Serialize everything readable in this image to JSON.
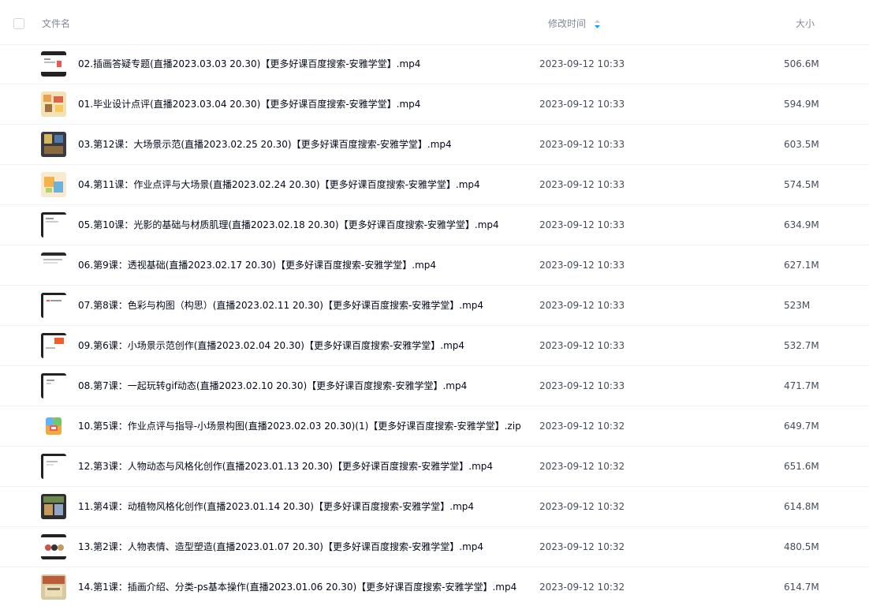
{
  "header": {
    "name_label": "文件名",
    "time_label": "修改时间",
    "size_label": "大小",
    "sort_icon": "sort-descending-icon"
  },
  "colors": {
    "sort_active": "#06a7ff",
    "text": "#03081a",
    "muted": "#818999"
  },
  "files": [
    {
      "name": "02.插画答疑专题(直播2023.03.03 20.30)【更多好课百度搜索-安雅学堂】.mp4",
      "time": "2023-09-12 10:33",
      "size": "506.6M",
      "icon": "video-thumbnail"
    },
    {
      "name": "01.毕业设计点评(直播2023.03.04 20.30)【更多好课百度搜索-安雅学堂】.mp4",
      "time": "2023-09-12 10:33",
      "size": "594.9M",
      "icon": "video-thumbnail"
    },
    {
      "name": "03.第12课：大场景示范(直播2023.02.25 20.30)【更多好课百度搜索-安雅学堂】.mp4",
      "time": "2023-09-12 10:33",
      "size": "603.5M",
      "icon": "video-thumbnail"
    },
    {
      "name": "04.第11课：作业点评与大场景(直播2023.02.24 20.30)【更多好课百度搜索-安雅学堂】.mp4",
      "time": "2023-09-12 10:33",
      "size": "574.5M",
      "icon": "video-thumbnail"
    },
    {
      "name": "05.第10课：光影的基础与材质肌理(直播2023.02.18 20.30)【更多好课百度搜索-安雅学堂】.mp4",
      "time": "2023-09-12 10:33",
      "size": "634.9M",
      "icon": "video-thumbnail"
    },
    {
      "name": "06.第9课：透视基础(直播2023.02.17 20.30)【更多好课百度搜索-安雅学堂】.mp4",
      "time": "2023-09-12 10:33",
      "size": "627.1M",
      "icon": "video-thumbnail"
    },
    {
      "name": "07.第8课：色彩与构图（构思）(直播2023.02.11 20.30)【更多好课百度搜索-安雅学堂】.mp4",
      "time": "2023-09-12 10:33",
      "size": "523M",
      "icon": "video-thumbnail"
    },
    {
      "name": "09.第6课：小场景示范创作(直播2023.02.04 20.30)【更多好课百度搜索-安雅学堂】.mp4",
      "time": "2023-09-12 10:33",
      "size": "532.7M",
      "icon": "video-thumbnail"
    },
    {
      "name": "08.第7课：一起玩转gif动态(直播2023.02.10 20.30)【更多好课百度搜索-安雅学堂】.mp4",
      "time": "2023-09-12 10:33",
      "size": "471.7M",
      "icon": "video-thumbnail"
    },
    {
      "name": "10.第5课：作业点评与指导-小场景构图(直播2023.02.03 20.30)(1)【更多好课百度搜索-安雅学堂】.zip",
      "time": "2023-09-12 10:32",
      "size": "649.7M",
      "icon": "zip-archive-icon"
    },
    {
      "name": "12.第3课：人物动态与风格化创作(直播2023.01.13 20.30)【更多好课百度搜索-安雅学堂】.mp4",
      "time": "2023-09-12 10:32",
      "size": "651.6M",
      "icon": "video-thumbnail"
    },
    {
      "name": "11.第4课：动植物风格化创作(直播2023.01.14 20.30)【更多好课百度搜索-安雅学堂】.mp4",
      "time": "2023-09-12 10:32",
      "size": "614.8M",
      "icon": "video-thumbnail"
    },
    {
      "name": "13.第2课：人物表情、造型塑造(直播2023.01.07 20.30)【更多好课百度搜索-安雅学堂】.mp4",
      "time": "2023-09-12 10:32",
      "size": "480.5M",
      "icon": "video-thumbnail"
    },
    {
      "name": "14.第1课：插画介绍、分类-ps基本操作(直播2023.01.06 20.30)【更多好课百度搜索-安雅学堂】.mp4",
      "time": "2023-09-12 10:32",
      "size": "614.7M",
      "icon": "video-thumbnail"
    }
  ]
}
